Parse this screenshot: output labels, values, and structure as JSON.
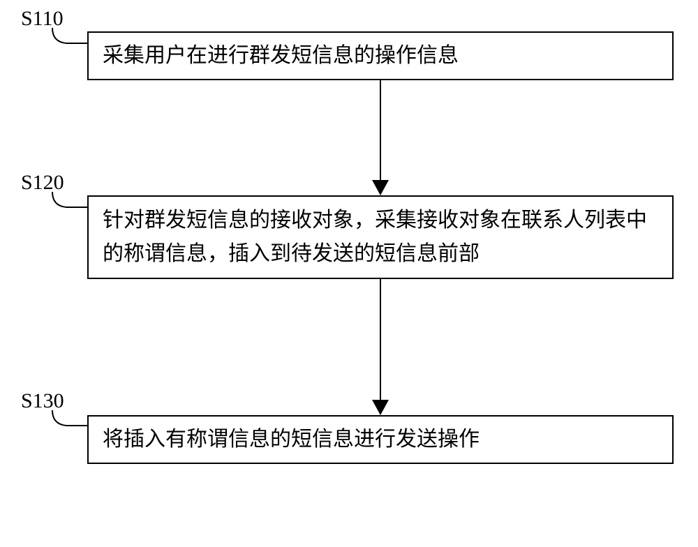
{
  "steps": [
    {
      "id": "S110",
      "text": "采集用户在进行群发短信息的操作信息"
    },
    {
      "id": "S120",
      "text": "针对群发短信息的接收对象，采集接收对象在联系人列表中的称谓信息，插入到待发送的短信息前部"
    },
    {
      "id": "S130",
      "text": "将插入有称谓信息的短信息进行发送操作"
    }
  ]
}
